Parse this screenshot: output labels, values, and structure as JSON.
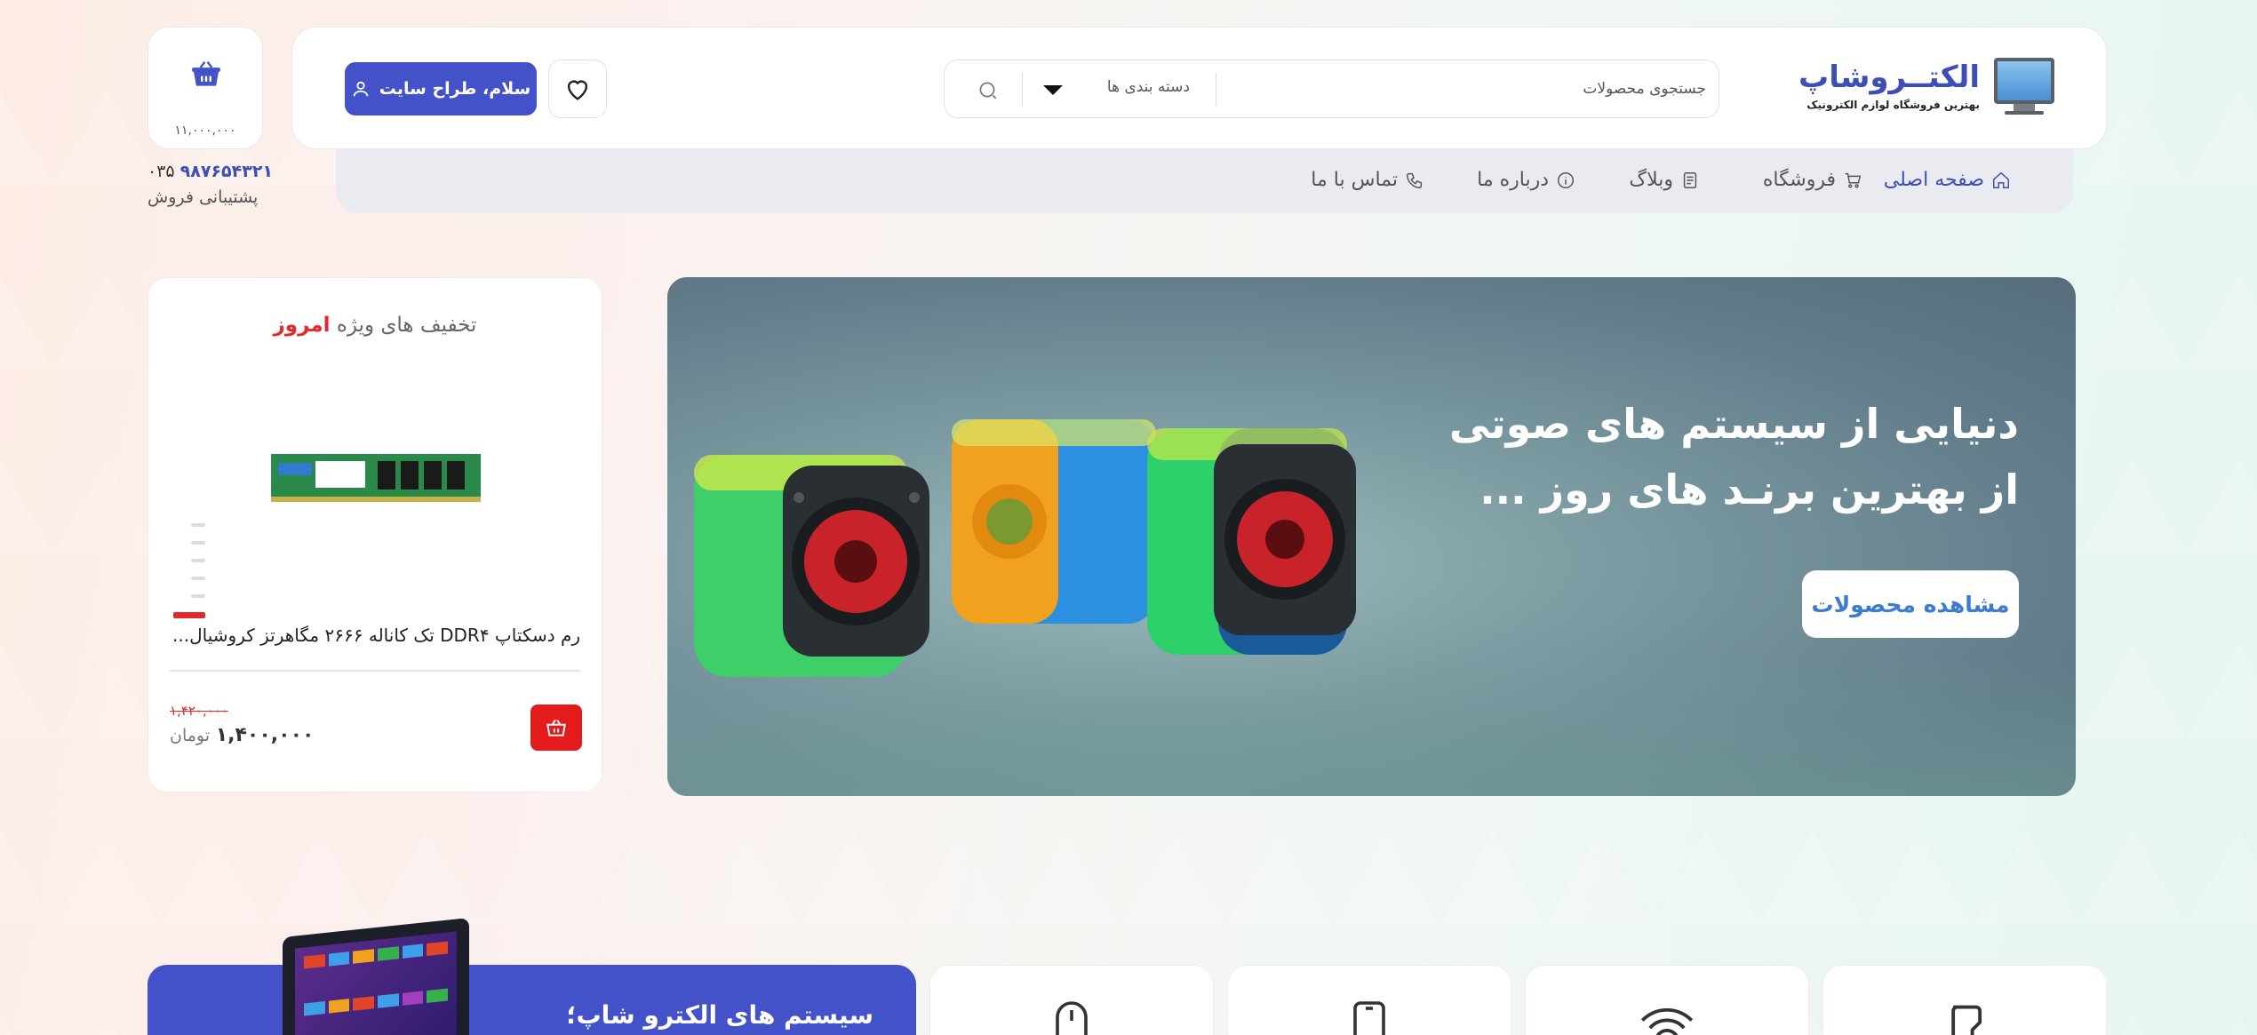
{
  "brand": {
    "name": "الکتــروشاپ",
    "tagline": "بهترین فروشگاه لوازم الکترونیک"
  },
  "search": {
    "placeholder": "جستجوی محصولات",
    "category_label": "دسته بندی ها"
  },
  "user": {
    "greeting": "سلام، طراح سایت"
  },
  "cart": {
    "total": "۱۱,۰۰۰,۰۰۰"
  },
  "support": {
    "phone_prefix": "۰۳۵",
    "phone_number": "۹۸۷۶۵۴۳۲۱",
    "label": "پشتیبانی فروش"
  },
  "nav": {
    "items": [
      {
        "label": "صفحه اصلی",
        "icon": "home-icon",
        "active": true
      },
      {
        "label": "فروشگاه",
        "icon": "cart-icon"
      },
      {
        "label": "وبلاگ",
        "icon": "document-icon"
      },
      {
        "label": "درباره ما",
        "icon": "info-icon"
      },
      {
        "label": "تماس با ما",
        "icon": "phone-icon"
      }
    ]
  },
  "hero": {
    "title_line1": "دنیایی از سیستم های صوتی",
    "title_line2": "از بهترین برنـد های روز ...",
    "button": "مشاهده محصولات"
  },
  "deal": {
    "title_main": "تخفیف های ویژه",
    "title_highlight": "امروز",
    "product_name": "رم دسکتاپ DDR۴ تک کاناله ۲۶۶۶ مگاهرتز کروشیال...",
    "old_price": "۱,۴۲۰,۰۰۰",
    "new_price": "۱,۴۰۰,۰۰۰",
    "currency": "تومان"
  },
  "systems": {
    "title": "سیستم های الکترو شاپ؛"
  },
  "colors": {
    "primary": "#4352c9",
    "accent_red": "#e12a2a",
    "nav_bg": "#e9ebf1"
  }
}
